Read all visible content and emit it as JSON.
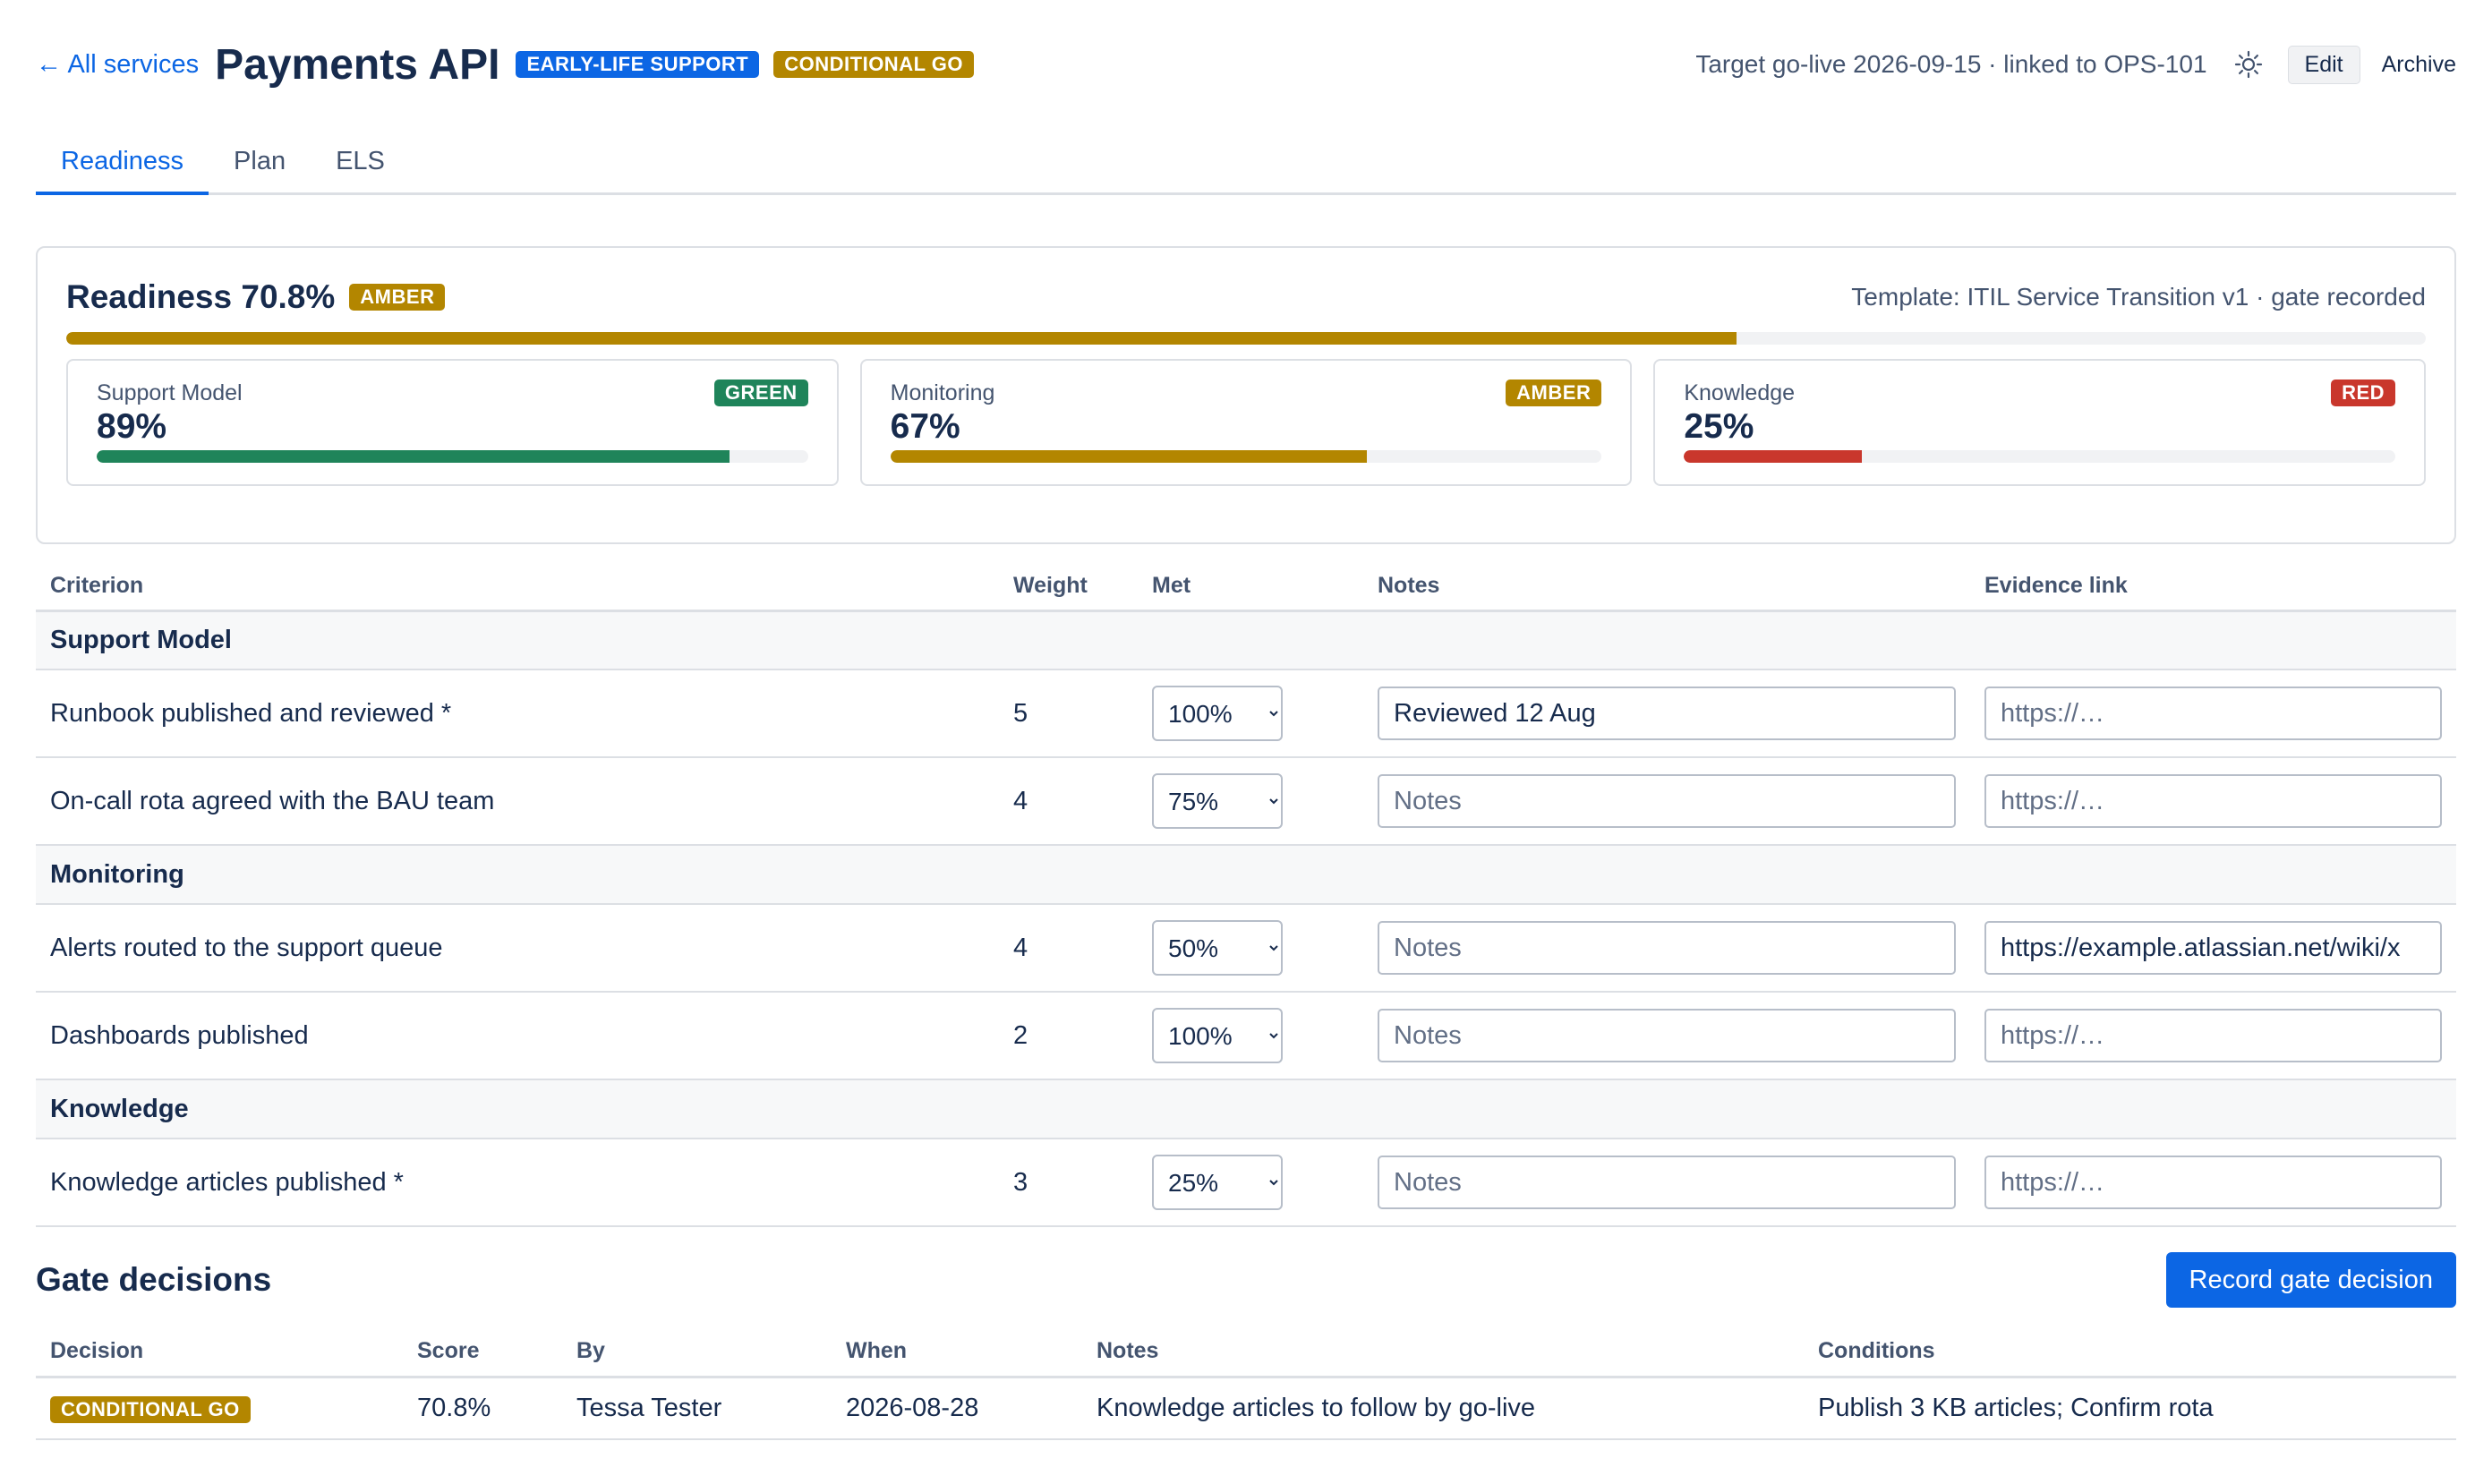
{
  "header": {
    "back_label": "← All services",
    "title": "Payments API",
    "badges": [
      "EARLY-LIFE SUPPORT",
      "CONDITIONAL GO"
    ],
    "target": "Target go-live 2026-09-15 · linked to OPS-101",
    "theme_icon": "sun-icon",
    "edit_label": "Edit",
    "archive_label": "Archive"
  },
  "tabs": [
    {
      "label": "Readiness",
      "active": true
    },
    {
      "label": "Plan",
      "active": false
    },
    {
      "label": "ELS",
      "active": false
    }
  ],
  "readiness": {
    "title": "Readiness 70.8%",
    "status": "AMBER",
    "score_fraction": 0.708,
    "meta": "Template: ITIL Service Transition v1 · gate recorded",
    "categories": [
      {
        "label": "Support Model",
        "pct": "89%",
        "value": 0.89,
        "status": "GREEN",
        "color": "#1f845a"
      },
      {
        "label": "Monitoring",
        "pct": "67%",
        "value": 0.67,
        "status": "AMBER",
        "color": "#b38600"
      },
      {
        "label": "Knowledge",
        "pct": "25%",
        "value": 0.25,
        "status": "RED",
        "color": "#c9372c"
      }
    ]
  },
  "criteria": {
    "columns": [
      "Criterion",
      "Weight",
      "Met",
      "Notes",
      "Evidence link"
    ],
    "groups": [
      "Support Model",
      "Monitoring",
      "Knowledge"
    ],
    "rows": [
      {
        "name": "Runbook published and reviewed *",
        "weight": "5",
        "met": "100%",
        "notes": "Reviewed 12 Aug",
        "evidence": ""
      },
      {
        "name": "On-call rota agreed with the BAU team",
        "weight": "4",
        "met": "75%",
        "notes": "",
        "evidence": ""
      },
      {
        "name": "Alerts routed to the support queue",
        "weight": "4",
        "met": "50%",
        "notes": "",
        "evidence": "https://example.atlassian.net/wiki/x"
      },
      {
        "name": "Dashboards published",
        "weight": "2",
        "met": "100%",
        "notes": "",
        "evidence": ""
      },
      {
        "name": "Knowledge articles published *",
        "weight": "3",
        "met": "25%",
        "notes": "",
        "evidence": ""
      }
    ],
    "notes_placeholder": "Notes",
    "evidence_placeholder": "https://…"
  },
  "gate": {
    "title": "Gate decisions",
    "record_label": "Record gate decision",
    "columns": [
      "Decision",
      "Score",
      "By",
      "When",
      "Notes",
      "Conditions"
    ],
    "rows": [
      {
        "decision": "CONDITIONAL GO",
        "score": "70.8%",
        "by": "Tessa Tester",
        "when": "2026-08-28",
        "notes": "Knowledge articles to follow by go-live",
        "conditions": "Publish 3 KB articles; Confirm rota"
      }
    ]
  },
  "colors": {
    "primary": "#0c66e4",
    "amber": "#b38600",
    "green": "#1f845a",
    "red": "#c9372c"
  }
}
